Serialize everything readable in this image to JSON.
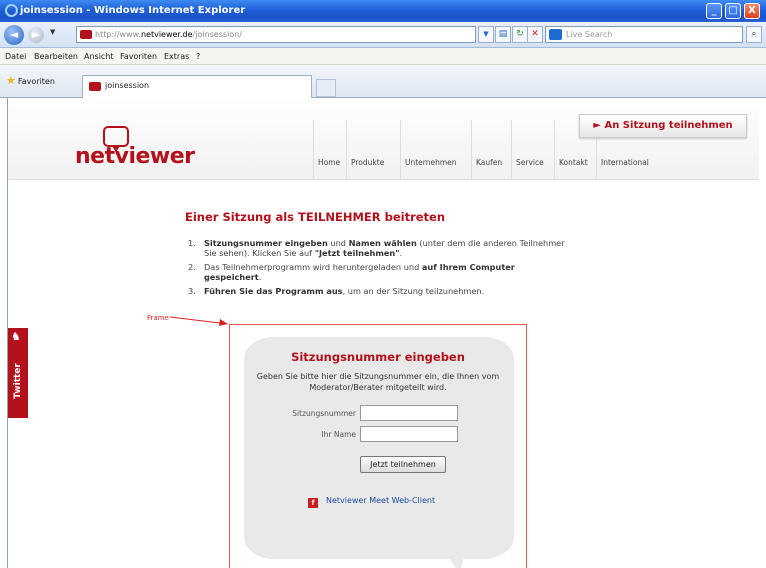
{
  "window": {
    "title": "joinsession - Windows Internet Explorer",
    "controls": {
      "minimize": "_",
      "maximize": "□",
      "close": "X"
    }
  },
  "toolbar": {
    "address_prefix": "http://www.",
    "address_host": "netviewer.de",
    "address_path": "/joinsession/",
    "search_placeholder": "Live Search"
  },
  "menu": [
    "Datei",
    "Bearbeiten",
    "Ansicht",
    "Favoriten",
    "Extras",
    "?"
  ],
  "favbar": {
    "favorites_label": "Favoriten",
    "tab_title": "joinsession"
  },
  "site": {
    "logo": "netviewer",
    "nav": [
      "Home",
      "Produkte",
      "Unternehmen",
      "Kaufen",
      "Service",
      "Kontakt",
      "International"
    ],
    "cta": "► An Sitzung teilnehmen"
  },
  "content": {
    "title": "Einer Sitzung als TEILNEHMER beitreten",
    "steps": [
      {
        "num": "1.",
        "bold1": "Sitzungsnummer eingeben",
        "t1": " und ",
        "bold2": "Namen wählen",
        "t2": " (unter dem die anderen Teilnehmer Sie sehen). Klicken Sie auf ",
        "bold3": "\"Jetzt teilnehmen\"",
        "t3": "."
      },
      {
        "num": "2.",
        "t1": "Das Teilnehmerprogramm wird heruntergeladen und ",
        "bold1": "auf Ihrem Computer gespeichert",
        "t2": "."
      },
      {
        "num": "3.",
        "bold1": "Führen Sie das Programm aus",
        "t1": ", um an der Sitzung teilzunehmen."
      }
    ]
  },
  "annotation": {
    "label": "Frame"
  },
  "form": {
    "title": "Sitzungsnummer eingeben",
    "description": "Geben Sie bitte hier die Sitzungsnummer ein, die Ihnen vom Moderator/Berater mitgeteilt wird.",
    "session_label": "Sitzungsnummer",
    "session_value": "",
    "name_label": "Ihr Name",
    "name_value": "",
    "submit_label": "Jetzt teilnehmen",
    "webclient_label": "Netviewer Meet Web-Client"
  },
  "twitter": {
    "label": "Twitter"
  },
  "colors": {
    "brand": "#b3121c",
    "annotation": "#dd2222",
    "titlebar": "#1f5fd6"
  }
}
